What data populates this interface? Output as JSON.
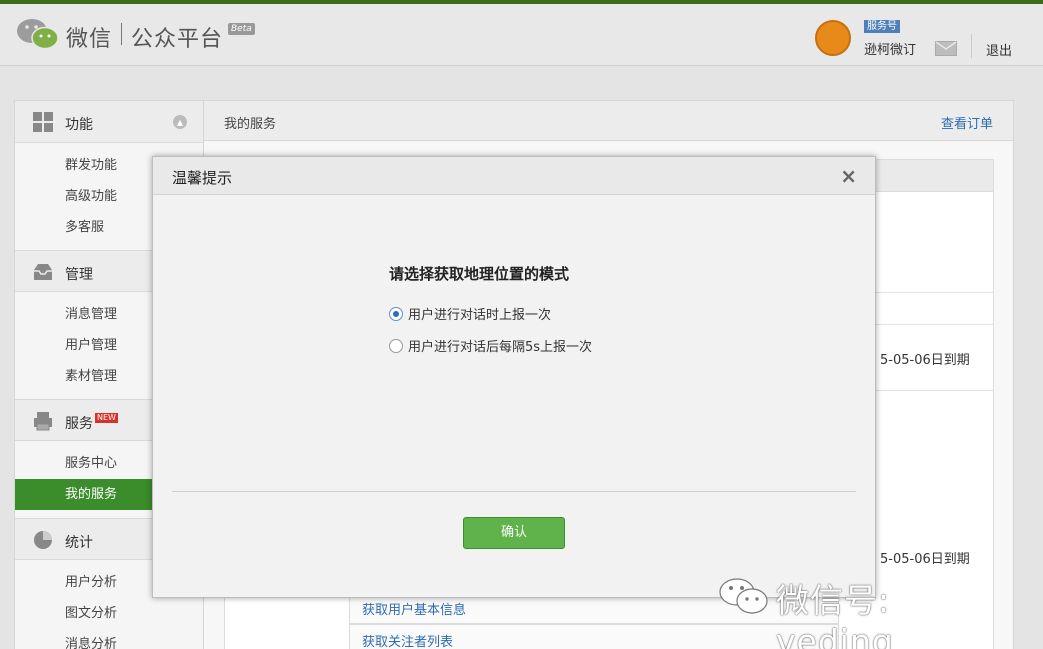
{
  "header": {
    "brand_left": "微信",
    "brand_right": "公众平台",
    "beta": "Beta",
    "account_badge": "服务号",
    "account_name": "逊柯微订",
    "logout": "退出"
  },
  "sidebar": {
    "sections": [
      {
        "label": "功能",
        "items": [
          "群发功能",
          "高级功能",
          "多客服"
        ]
      },
      {
        "label": "管理",
        "items": [
          "消息管理",
          "用户管理",
          "素材管理"
        ]
      },
      {
        "label": "服务",
        "new_badge": "NEW",
        "items": [
          "服务中心",
          "我的服务"
        ]
      },
      {
        "label": "统计",
        "items": [
          "用户分析",
          "图文分析",
          "消息分析"
        ]
      }
    ],
    "active_item": "我的服务"
  },
  "main": {
    "title": "我的服务",
    "order_link": "查看订单",
    "expire_1": "5-05-06日到期",
    "expire_2": "5-05-06日到期",
    "link_1": "获取用户基本信息",
    "link_2": "获取关注者列表"
  },
  "modal": {
    "title": "温馨提示",
    "close": "×",
    "question": "请选择获取地理位置的模式",
    "options": [
      {
        "label": "用户进行对话时上报一次",
        "selected": true
      },
      {
        "label": "用户进行对话后每隔5s上报一次",
        "selected": false
      }
    ],
    "confirm": "确认"
  },
  "watermark": {
    "text": "微信号: veding"
  },
  "colors": {
    "accent_green": "#3b8c2a",
    "button_green": "#5fb34a",
    "link_blue": "#2b6cb3"
  }
}
